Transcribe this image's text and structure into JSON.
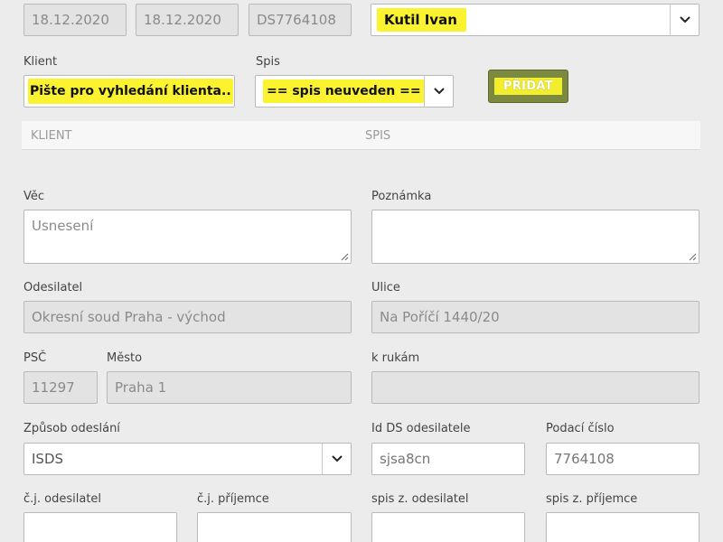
{
  "top": {
    "date1": "18.12.2020",
    "date2": "18.12.2020",
    "ds_id": "DS7764108",
    "assignee": "Kutil Ivan"
  },
  "klient": {
    "label": "Klient",
    "placeholder": "Pište pro vyhledání klienta.."
  },
  "spis": {
    "label": "Spis",
    "value": "== spis neuveden =="
  },
  "add_button": {
    "label": "PŘIDAT"
  },
  "table": {
    "columns": [
      "KLIENT",
      "SPIS"
    ]
  },
  "vec": {
    "label": "Věc",
    "value": "Usnesení"
  },
  "poznamka": {
    "label": "Poznámka",
    "value": ""
  },
  "odesilatel": {
    "label": "Odesilatel",
    "value": "Okresní soud Praha - východ"
  },
  "ulice": {
    "label": "Ulice",
    "value": "Na Poříčí 1440/20"
  },
  "psc": {
    "label": "PSČ",
    "value": "11297"
  },
  "mesto": {
    "label": "Město",
    "value": "Praha 1"
  },
  "k_rukam": {
    "label": "k rukám",
    "value": ""
  },
  "zpusob": {
    "label": "Způsob odeslání",
    "value": "ISDS"
  },
  "id_ds": {
    "label": "Id DS odesilatele",
    "value": "sjsa8cn"
  },
  "podaci": {
    "label": "Podací číslo",
    "value": "7764108"
  },
  "cj_odesilatel": {
    "label": "č.j. odesilatel",
    "value": ""
  },
  "cj_prijemce": {
    "label": "č.j. příjemce",
    "value": ""
  },
  "spis_odesilatel": {
    "label": "spis z. odesilatel",
    "value": ""
  },
  "spis_prijemce": {
    "label": "spis z. příjemce",
    "value": ""
  },
  "colors": {
    "highlight": "#fbf230",
    "button": "#7b8a3f",
    "readonly_bg": "#e3e3e3"
  }
}
